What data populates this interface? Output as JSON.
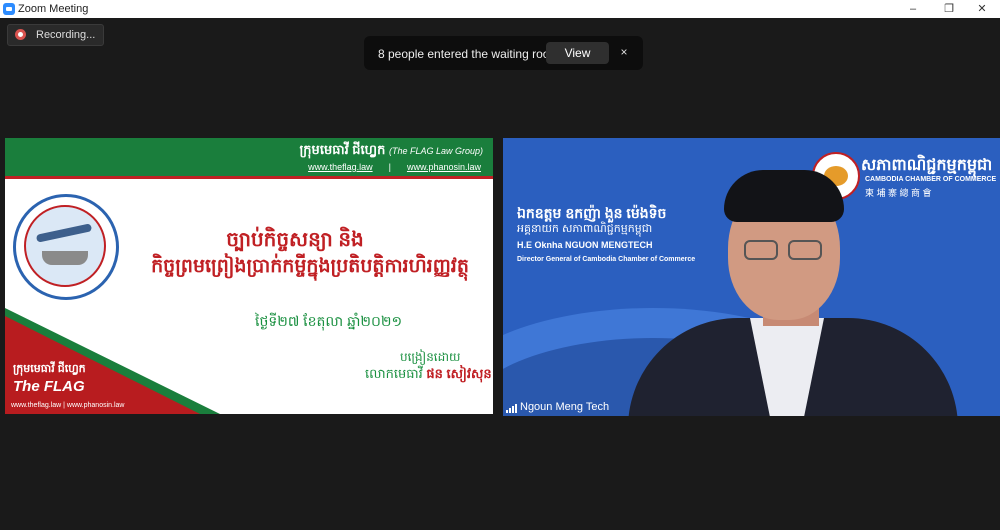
{
  "window": {
    "title": "Zoom Meeting",
    "controls": [
      "–",
      "❐",
      "✕"
    ]
  },
  "recording": {
    "label": "Recording..."
  },
  "notification": {
    "message": "8 people entered the waiting room",
    "view_label": "View",
    "close_label": "×"
  },
  "shared_screen": {
    "org_title": "ក្រុមមេធាវី ជីហ្វ្លេក",
    "org_title_en": "(The FLAG Law Group)",
    "link1": "www.theflag.law",
    "separator": "|",
    "link2": "www.phanosin.law",
    "title_line1": "ច្បាប់កិច្ចសន្យា និង",
    "title_line2": "កិច្ចព្រមព្រៀងប្រាក់កម្ចីក្នុងប្រតិបត្តិការហិរញ្ញវត្ថុ",
    "date": "ថ្ងៃទី២៧ ខែតុលា ឆ្នាំ២០២១",
    "presented_by": "បង្រៀនដោយ",
    "presenter_prefix": "លោកមេធាវី",
    "presenter_name": "ផន សៀវសុន",
    "footer_org": "ក្រុមមេធាវី ជីហ្វ្លេក",
    "footer_logo": "The FLAG",
    "footer_links": "www.theflag.law | www.phanosin.law"
  },
  "camera": {
    "org_kh": "សភាពាណិជ្ជកម្មកម្ពុជា",
    "org_en": "CAMBODIA CHAMBER OF COMMERCE",
    "org_zh": "柬 埔 寨 總 商 會",
    "name_kh": "ឯកឧត្តម ឧកញ៉ា ងួន ម៉េងទិច",
    "title_kh": "អគ្គនាយក សភាពាណិជ្ជកម្មកម្ពុជា",
    "name_en": "H.E Oknha NGUON MENGTECH",
    "role_en": "Director General of Cambodia Chamber of Commerce",
    "participant_name": "Ngoun Meng Tech"
  },
  "colors": {
    "green": "#1a7e3c",
    "red": "#c02024",
    "blue": "#2b5fbf"
  }
}
